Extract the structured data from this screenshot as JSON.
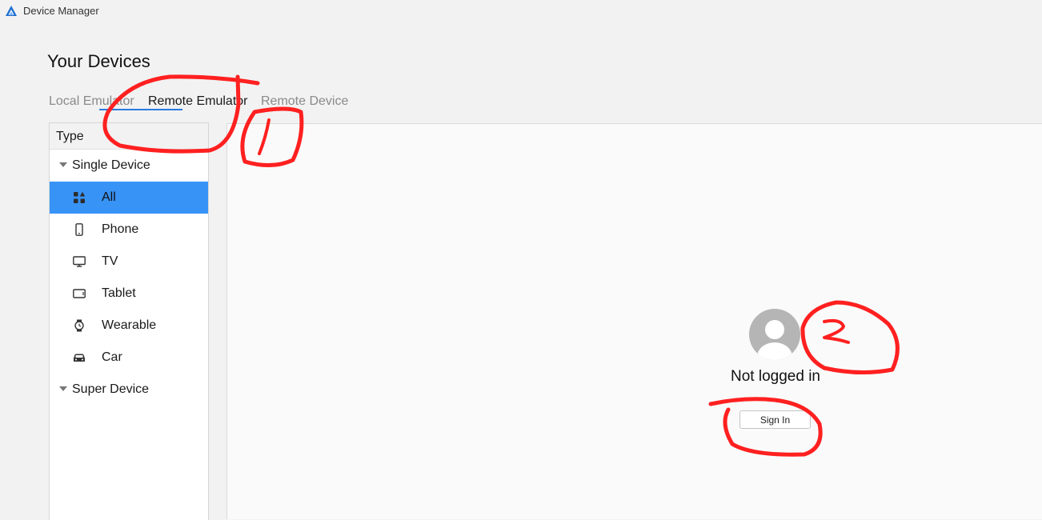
{
  "app": {
    "title": "Device Manager",
    "logo_icon": "deveco-logo-icon"
  },
  "page": {
    "title": "Your Devices"
  },
  "tabs": [
    {
      "label": "Local Emulator",
      "active": false
    },
    {
      "label": "Remote Emulator",
      "active": true
    },
    {
      "label": "Remote Device",
      "active": false
    }
  ],
  "sidebar": {
    "header": "Type",
    "groups": [
      {
        "label": "Single Device",
        "expanded": true
      },
      {
        "label": "Super Device",
        "expanded": true
      }
    ],
    "items": [
      {
        "label": "All",
        "icon": "grid-icon",
        "selected": true
      },
      {
        "label": "Phone",
        "icon": "phone-icon",
        "selected": false
      },
      {
        "label": "TV",
        "icon": "tv-icon",
        "selected": false
      },
      {
        "label": "Tablet",
        "icon": "tablet-icon",
        "selected": false
      },
      {
        "label": "Wearable",
        "icon": "watch-icon",
        "selected": false
      },
      {
        "label": "Car",
        "icon": "car-icon",
        "selected": false
      }
    ]
  },
  "login": {
    "status": "Not logged in",
    "button": "Sign In",
    "avatar_icon": "user-avatar-icon"
  },
  "annotations": [
    {
      "label": "1",
      "color": "#ff2020"
    },
    {
      "label": "2",
      "color": "#ff2020"
    }
  ],
  "colors": {
    "accent": "#2a7ae2",
    "selection": "#3893f7",
    "annotation": "#ff2020"
  }
}
